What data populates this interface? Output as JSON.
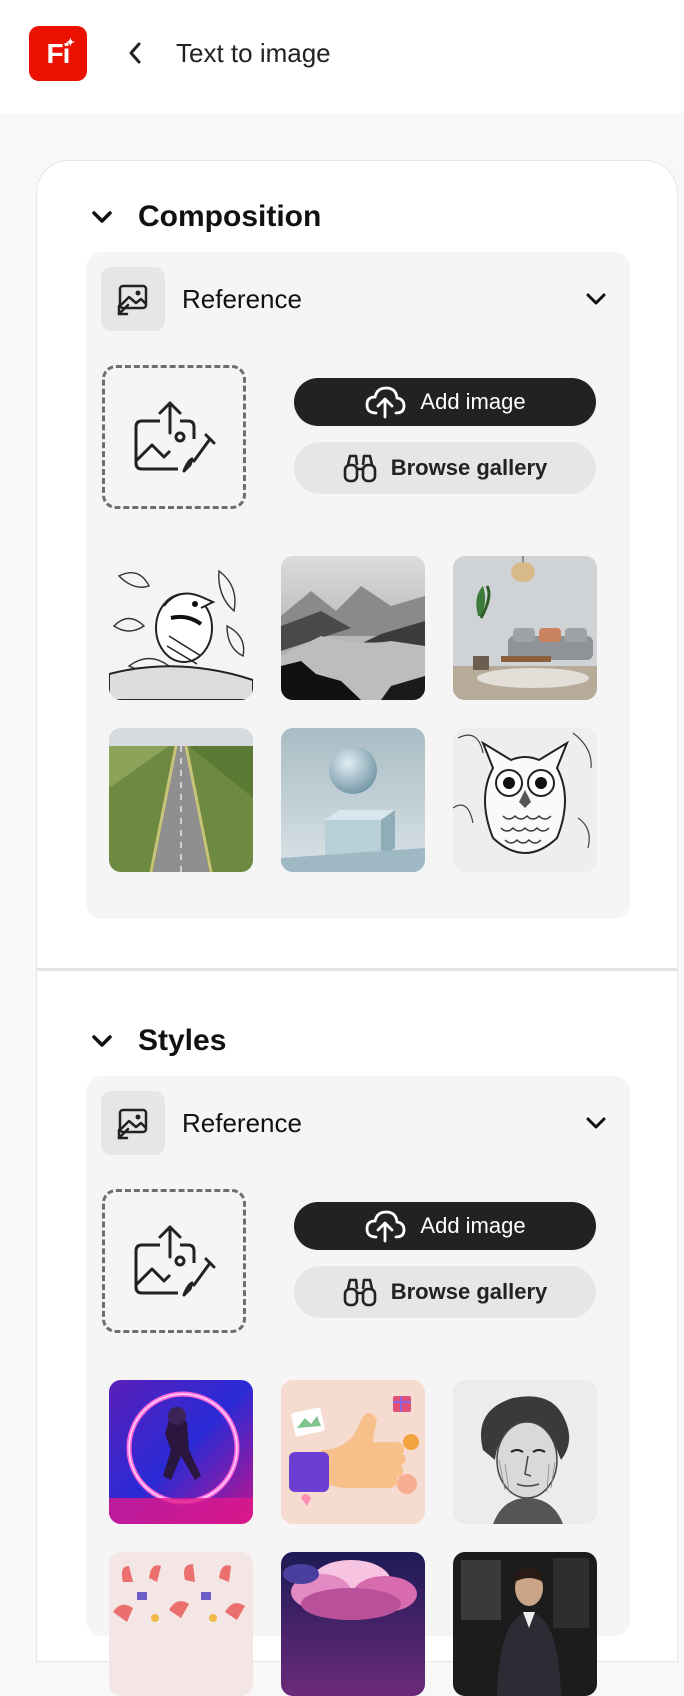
{
  "header": {
    "app_logo_text": "Fi",
    "page_title": "Text to image",
    "logo_color": "#eb1000"
  },
  "sections": [
    {
      "title": "Composition",
      "reference_label": "Reference",
      "add_image_label": "Add image",
      "browse_gallery_label": "Browse gallery",
      "thumbnails": [
        "bird-line-art",
        "misty-mountain-lake",
        "living-room-interior",
        "straight-road-through-fields",
        "sphere-on-cube",
        "owl-line-art"
      ]
    },
    {
      "title": "Styles",
      "reference_label": "Reference",
      "add_image_label": "Add image",
      "browse_gallery_label": "Browse gallery",
      "thumbnails": [
        "neon-ring-astronaut",
        "3d-thumbs-up",
        "engraved-portrait",
        "hands-pattern",
        "pink-clouds",
        "man-in-suit-portrait"
      ]
    }
  ],
  "colors": {
    "primary_button": "#222222",
    "secondary_button": "#e6e6e6",
    "card_background": "#f5f5f5"
  }
}
